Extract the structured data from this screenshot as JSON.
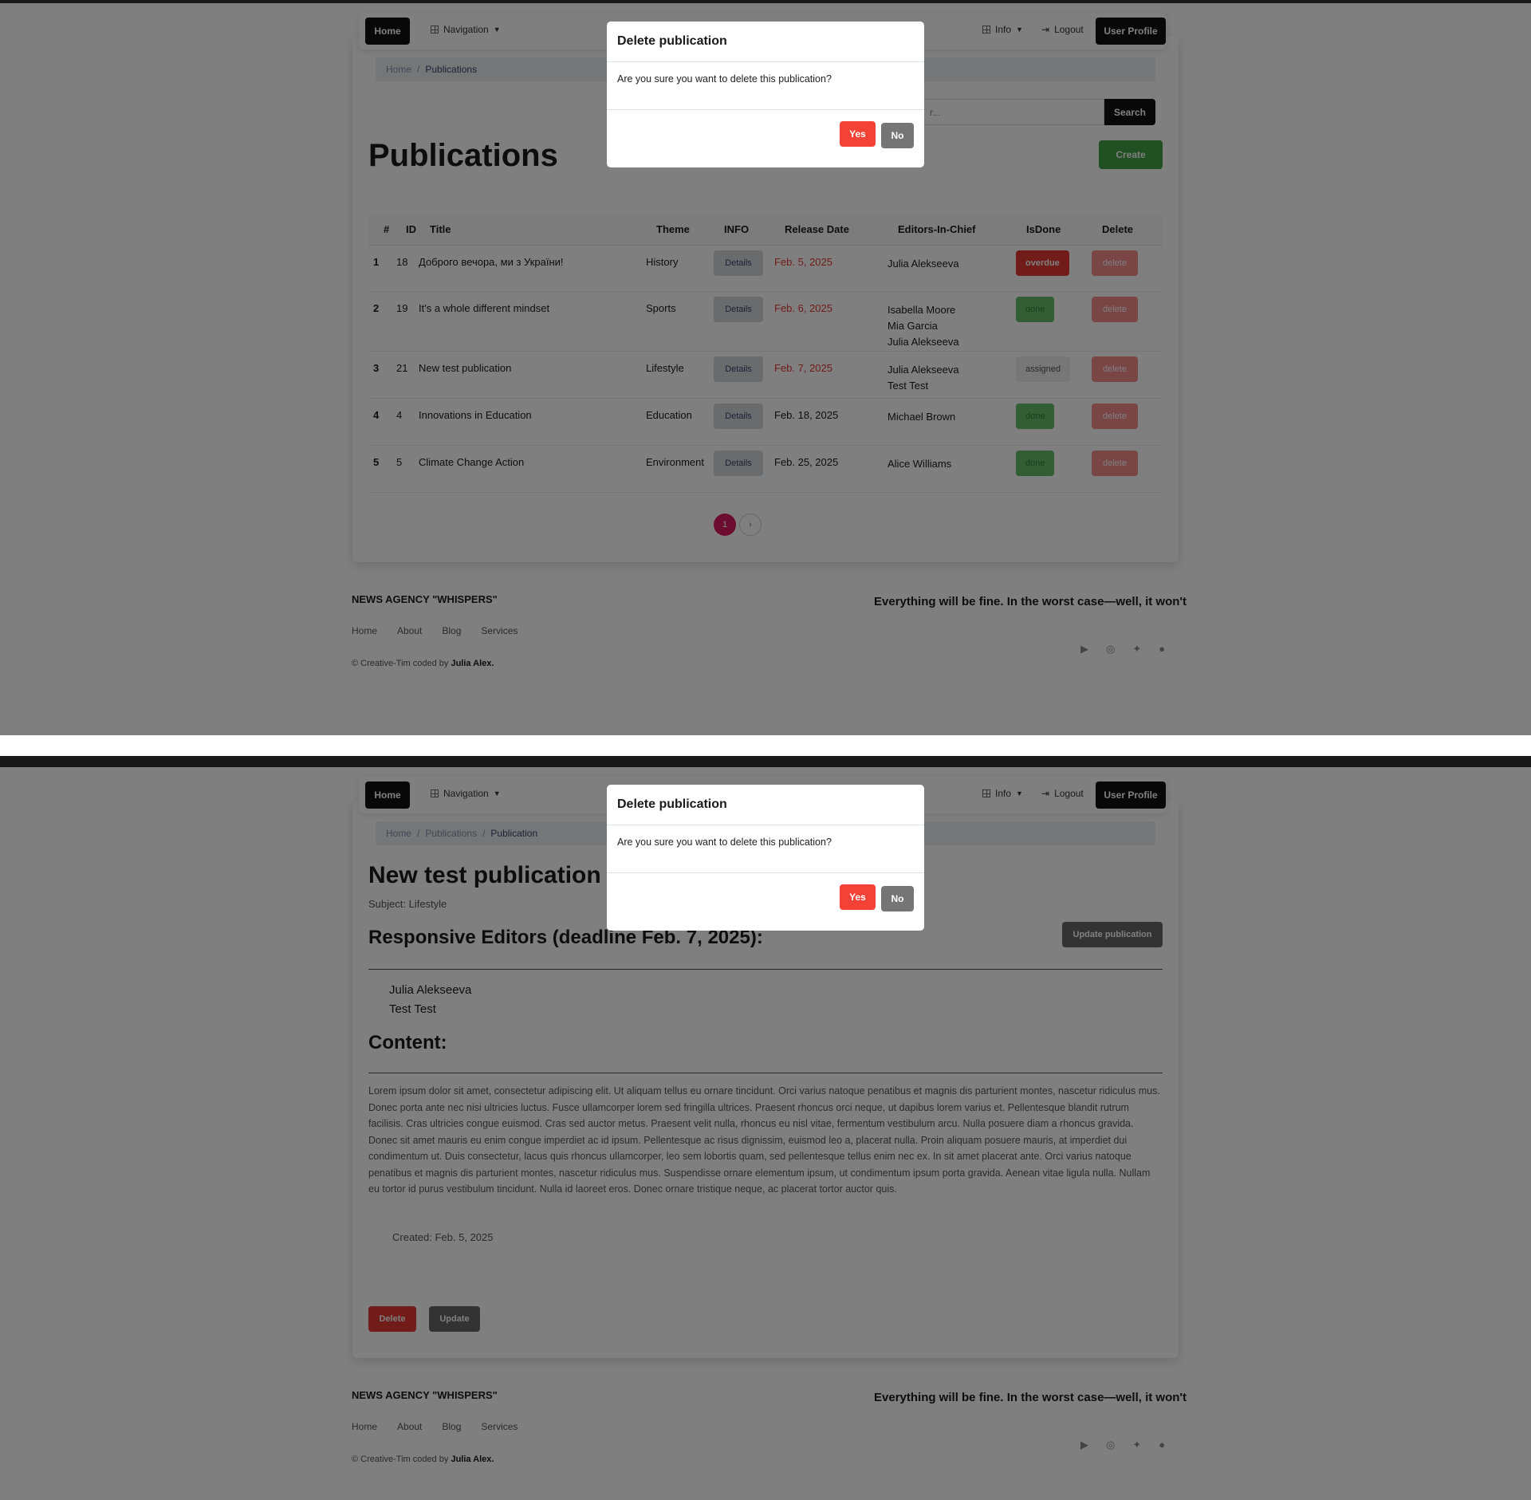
{
  "nav": {
    "home": "Home",
    "navigation": "Navigation",
    "info": "Info",
    "logout": "Logout",
    "user_profile": "User Profile"
  },
  "list_page": {
    "breadcrumb": [
      "Home",
      "Publications"
    ],
    "search_placeholder": "r...",
    "search_button": "Search",
    "title": "Publications",
    "create_button": "Create",
    "table": {
      "headers": [
        "#",
        "ID",
        "Title",
        "Theme",
        "INFO",
        "Release Date",
        "Editors-In-Chief",
        "IsDone",
        "Delete"
      ],
      "rows": [
        {
          "num": "1",
          "id": "18",
          "title": "Доброго вечора, ми з України!",
          "theme": "History",
          "details": "Details",
          "date": "Feb. 5, 2025",
          "date_overdue": true,
          "editors": "Julia Alekseeva",
          "status": "overdue",
          "delete": "delete"
        },
        {
          "num": "2",
          "id": "19",
          "title": "It's a whole different mindset",
          "theme": "Sports",
          "details": "Details",
          "date": "Feb. 6, 2025",
          "date_overdue": true,
          "editors": "Isabella Moore\nMia Garcia\nJulia Alekseeva",
          "status": "done",
          "delete": "delete"
        },
        {
          "num": "3",
          "id": "21",
          "title": "New test publication",
          "theme": "Lifestyle",
          "details": "Details",
          "date": "Feb. 7, 2025",
          "date_overdue": true,
          "editors": "Julia Alekseeva\nTest Test",
          "status": "assigned",
          "delete": "delete"
        },
        {
          "num": "4",
          "id": "4",
          "title": "Innovations in Education",
          "theme": "Education",
          "details": "Details",
          "date": "Feb. 18, 2025",
          "date_overdue": false,
          "editors": "Michael Brown",
          "status": "done",
          "delete": "delete"
        },
        {
          "num": "5",
          "id": "5",
          "title": "Climate Change Action",
          "theme": "Environment",
          "details": "Details",
          "date": "Feb. 25, 2025",
          "date_overdue": false,
          "editors": "Alice Williams",
          "status": "done",
          "delete": "delete"
        }
      ]
    },
    "pagination": {
      "current": "1",
      "next": "›"
    }
  },
  "detail_page": {
    "breadcrumb": [
      "Home",
      "Publications",
      "Publication"
    ],
    "title": "New test publication",
    "subject": "Subject: Lifestyle",
    "editors_heading": "Responsive Editors (deadline Feb. 7, 2025):",
    "update_publication_button": "Update publication",
    "editors": [
      "Julia Alekseeva",
      "Test Test"
    ],
    "content_heading": "Content:",
    "content": "Lorem ipsum dolor sit amet, consectetur adipiscing elit. Ut aliquam tellus eu ornare tincidunt. Orci varius natoque penatibus et magnis dis parturient montes, nascetur ridiculus mus. Donec porta ante nec nisi ultricies luctus. Fusce ullamcorper lorem sed fringilla ultrices. Praesent rhoncus orci neque, ut dapibus lorem varius et. Pellentesque blandit rutrum facilisis. Cras ultricies congue euismod. Cras sed auctor metus. Praesent velit nulla, rhoncus eu nisl vitae, fermentum vestibulum arcu. Nulla posuere diam a rhoncus gravida. Donec sit amet mauris eu enim congue imperdiet ac id ipsum. Pellentesque ac risus dignissim, euismod leo a, placerat nulla. Proin aliquam posuere mauris, at imperdiet dui condimentum ut. Duis consectetur, lacus quis rhoncus ullamcorper, leo sem lobortis quam, sed pellentesque tellus enim nec ex. In sit amet placerat ante. Orci varius natoque penatibus et magnis dis parturient montes, nascetur ridiculus mus. Suspendisse ornare elementum ipsum, ut condimentum ipsum porta gravida. Aenean vitae ligula nulla. Nullam eu tortor id purus vestibulum tincidunt. Nulla id laoreet eros. Donec ornare tristique neque, ac placerat tortor auctor quis.",
    "created": "Created: Feb. 5, 2025",
    "delete_button": "Delete",
    "update_button": "Update"
  },
  "modal": {
    "title": "Delete publication",
    "body": "Are you sure you want to delete this publication?",
    "yes": "Yes",
    "no": "No"
  },
  "footer": {
    "brand": "NEWS AGENCY \"WHISPERS\"",
    "tagline": "Everything will be fine. In the worst case—well, it won't",
    "links": [
      "Home",
      "About",
      "Blog",
      "Services"
    ],
    "copyright_prefix": "© Creative-Tim coded by",
    "copyright_author": "Julia Alex.",
    "social_icons": [
      "youtube-icon",
      "dribbble-icon",
      "twitter-icon",
      "github-icon"
    ]
  },
  "colors": {
    "status_overdue": "#e53935",
    "status_done": "#66bb6a",
    "create_green": "#43a047",
    "pager_active": "#d81b60"
  }
}
